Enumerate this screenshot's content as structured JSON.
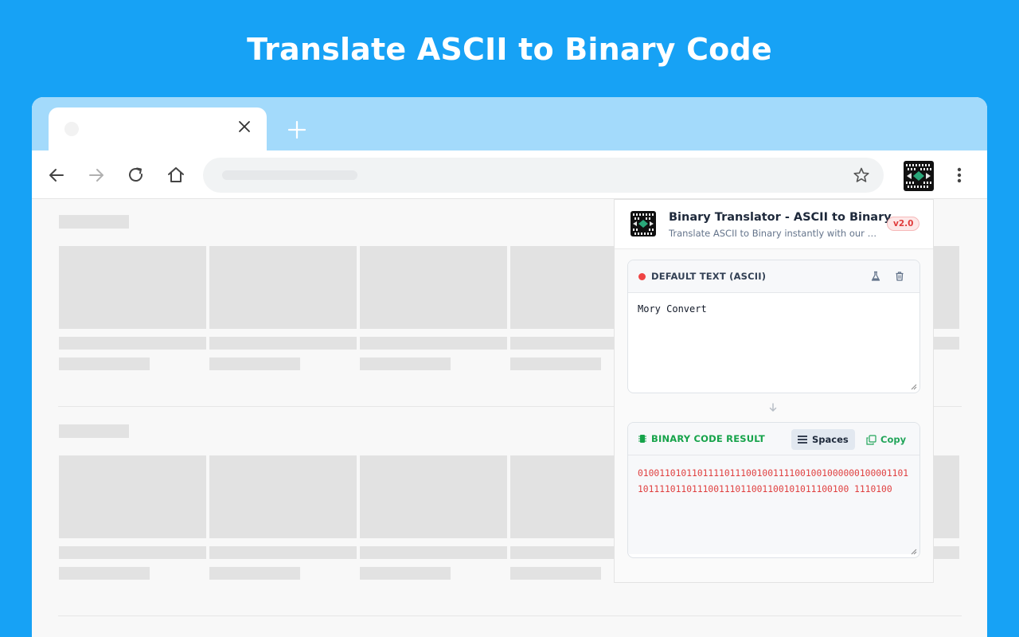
{
  "headline": "Translate ASCII to Binary Code",
  "browser": {
    "tab_close_icon": "close-icon",
    "new_tab_icon": "plus-icon",
    "nav_icons": [
      "back-arrow-icon",
      "forward-arrow-icon",
      "reload-icon",
      "home-icon"
    ],
    "bookmark_icon": "star-icon",
    "extension_icon": "binary-translator-extension-icon",
    "menu_icon": "kebab-menu-icon"
  },
  "popup": {
    "title": "Binary Translator - ASCII to Binary",
    "subtitle": "Translate ASCII to Binary instantly with our binary translator tool",
    "version": "v2.0",
    "input_card": {
      "label": "DEFAULT TEXT (ASCII)",
      "value": "Mory Convert",
      "sample_icon": "flask-icon",
      "clear_icon": "trash-icon"
    },
    "result_card": {
      "label": "BINARY CODE RESULT",
      "spaces_label": "Spaces",
      "copy_label": "Copy",
      "value": "01001101011011110111001001111001001000000100001101101111011011100111011001100101011100100 1110100"
    }
  },
  "colors": {
    "background": "#17a2f5",
    "tabstrip": "#a3dafb",
    "accent_red": "#ef4444",
    "accent_green": "#16a34a",
    "binary_text": "#e04040"
  }
}
